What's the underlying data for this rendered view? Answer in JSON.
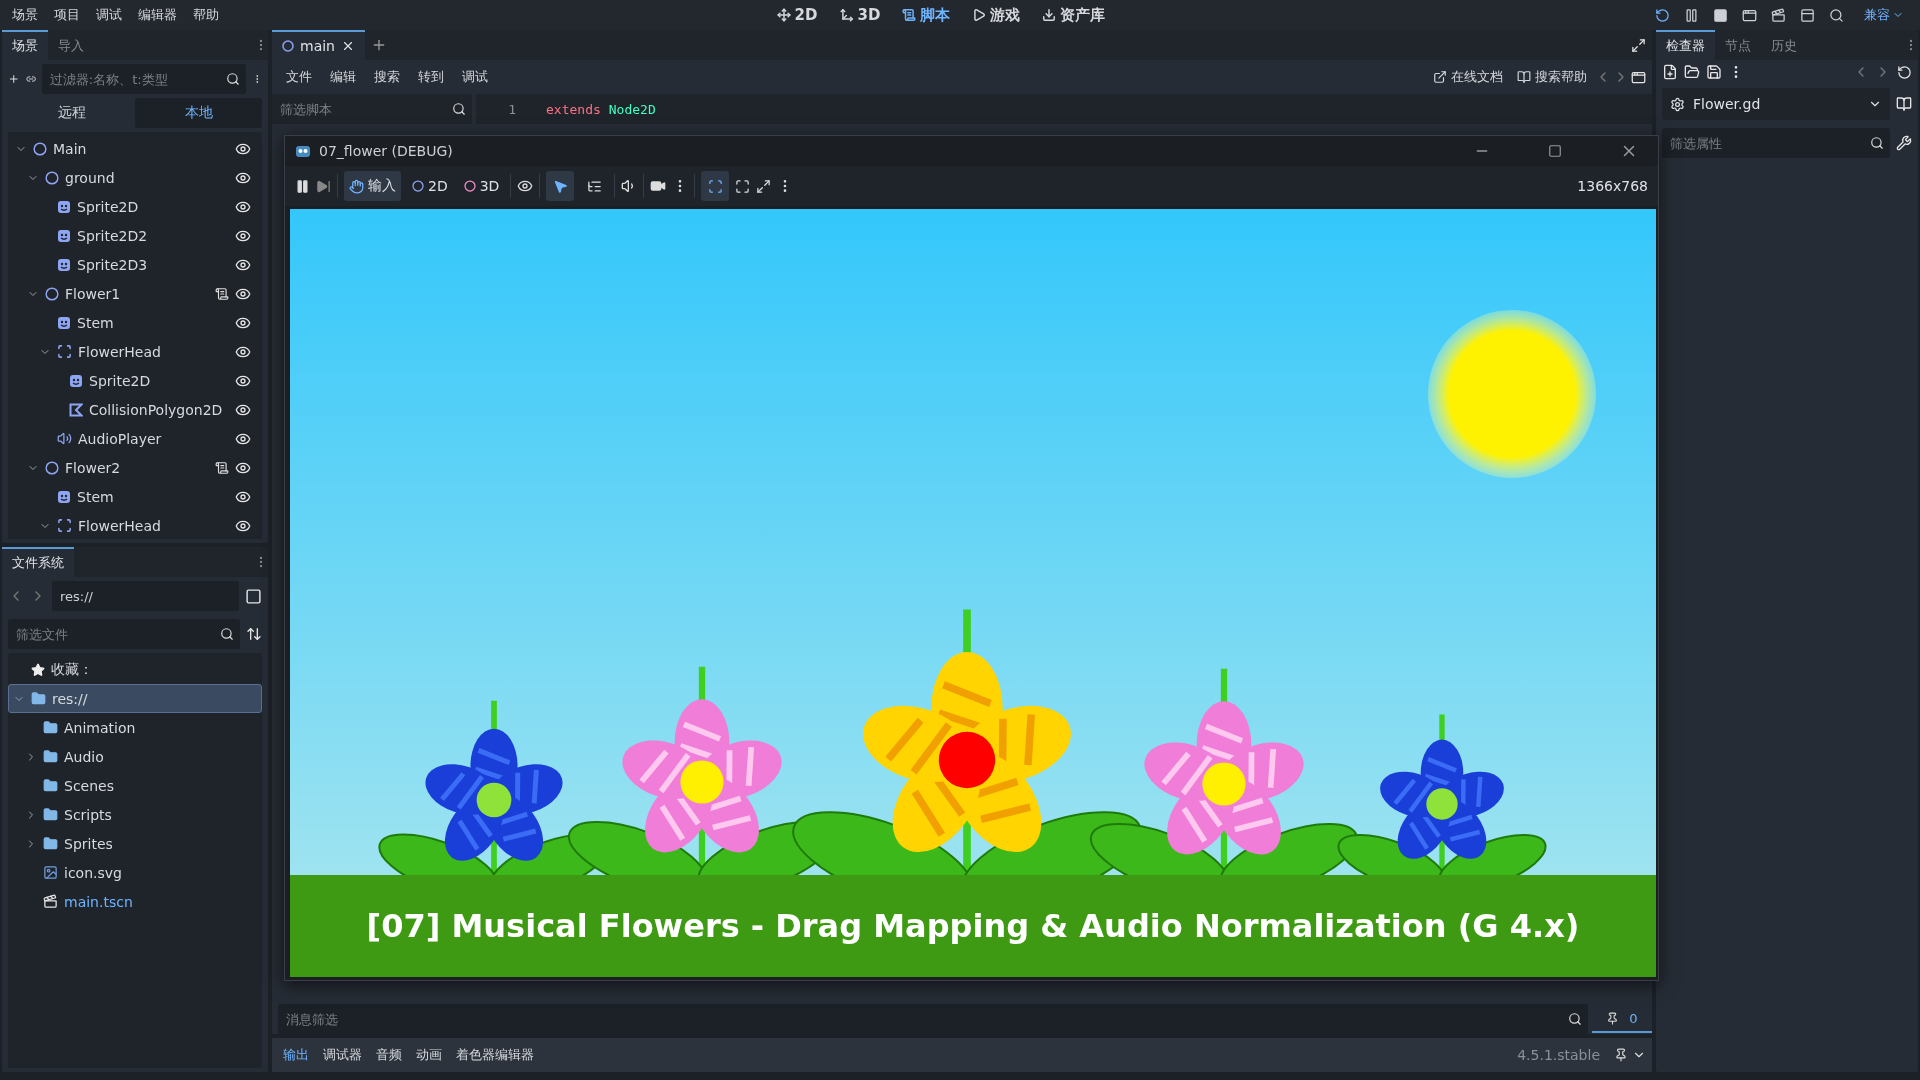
{
  "menu": [
    "场景",
    "项目",
    "调试",
    "编辑器",
    "帮助"
  ],
  "workspaces": [
    {
      "label": "2D",
      "kind": "planar",
      "selected": false
    },
    {
      "label": "3D",
      "kind": "spatial",
      "selected": false
    },
    {
      "label": "脚本",
      "kind": "script",
      "selected": true
    },
    {
      "label": "游戏",
      "kind": "game",
      "selected": false
    },
    {
      "label": "资产库",
      "kind": "assetlib",
      "selected": false
    }
  ],
  "renderer": "兼容",
  "scene_dock": {
    "tabs": [
      {
        "label": "场景",
        "selected": true
      },
      {
        "label": "导入",
        "selected": false
      }
    ],
    "filter_placeholder": "过滤器:名称、t:类型",
    "modes": [
      {
        "label": "远程",
        "selected": false
      },
      {
        "label": "本地",
        "selected": true
      }
    ],
    "tree": [
      {
        "name": "Main",
        "kind": "node2d",
        "expanded": true,
        "script": false,
        "children": [
          {
            "name": "ground",
            "kind": "node2d",
            "expanded": true,
            "script": false,
            "children": [
              {
                "name": "Sprite2D",
                "kind": "sprite",
                "script": false
              },
              {
                "name": "Sprite2D2",
                "kind": "sprite",
                "script": false
              },
              {
                "name": "Sprite2D3",
                "kind": "sprite",
                "script": false
              }
            ]
          },
          {
            "name": "Flower1",
            "kind": "node2d",
            "expanded": true,
            "script": true,
            "children": [
              {
                "name": "Stem",
                "kind": "sprite",
                "script": false
              },
              {
                "name": "FlowerHead",
                "kind": "area",
                "expanded": true,
                "script": false,
                "children": [
                  {
                    "name": "Sprite2D",
                    "kind": "sprite",
                    "script": false
                  },
                  {
                    "name": "CollisionPolygon2D",
                    "kind": "collision",
                    "script": false
                  }
                ]
              },
              {
                "name": "AudioPlayer",
                "kind": "audio",
                "script": false
              }
            ]
          },
          {
            "name": "Flower2",
            "kind": "node2d",
            "expanded": true,
            "script": true,
            "children": [
              {
                "name": "Stem",
                "kind": "sprite",
                "script": false
              },
              {
                "name": "FlowerHead",
                "kind": "area",
                "expanded": true,
                "script": false
              }
            ]
          }
        ]
      }
    ]
  },
  "filesystem": {
    "tab": "文件系统",
    "path": "res://",
    "filter_placeholder": "筛选文件",
    "favorites": "收藏：",
    "tree": [
      {
        "name": "res://",
        "kind": "folder",
        "expanded": true,
        "selected": true,
        "opened": false,
        "children": [
          {
            "name": "Animation",
            "kind": "folder",
            "selected": false,
            "opened": false
          },
          {
            "name": "Audio",
            "kind": "folder",
            "expanded": false,
            "selected": false,
            "opened": false
          },
          {
            "name": "Scenes",
            "kind": "folder",
            "selected": false,
            "opened": false
          },
          {
            "name": "Scripts",
            "kind": "folder",
            "expanded": false,
            "selected": false,
            "opened": false
          },
          {
            "name": "Sprites",
            "kind": "folder",
            "expanded": false,
            "selected": false,
            "opened": false
          },
          {
            "name": "icon.svg",
            "kind": "image",
            "selected": false,
            "opened": false
          },
          {
            "name": "main.tscn",
            "kind": "scene",
            "selected": false,
            "opened": true
          }
        ]
      }
    ]
  },
  "editor": {
    "tabs": [
      {
        "label": "main",
        "selected": true
      }
    ],
    "script_menu": [
      "文件",
      "编辑",
      "搜索",
      "转到",
      "调试"
    ],
    "online_docs": "在线文档",
    "search_help": "搜索帮助",
    "script_filter_placeholder": "筛选脚本",
    "code": [
      {
        "number": "1",
        "keyword": "extends",
        "type": "Node2D"
      }
    ]
  },
  "debug_window": {
    "title": "07_flower (DEBUG)",
    "input_label": "输入",
    "input_selected": true,
    "view_modes": [
      {
        "label": "2D",
        "kind": "planar"
      },
      {
        "label": "3D",
        "kind": "spatial"
      }
    ],
    "tools": [
      {
        "kind": "select",
        "selected": true
      },
      {
        "kind": "list",
        "selected": false
      }
    ],
    "camera_override": true,
    "resolution": "1366x768",
    "game_title": "[07] Musical Flowers - Drag Mapping & Audio Normalization (G 4.x)"
  },
  "bottom_panel": {
    "message_filter_placeholder": "消息筛选",
    "count": "0",
    "tabs": [
      {
        "label": "输出",
        "selected": true
      },
      {
        "label": "调试器",
        "selected": false
      },
      {
        "label": "音频",
        "selected": false
      },
      {
        "label": "动画",
        "selected": false
      },
      {
        "label": "着色器编辑器",
        "selected": false
      }
    ],
    "version": "4.5.1.stable"
  },
  "inspector": {
    "tabs": [
      {
        "label": "检查器",
        "selected": true
      },
      {
        "label": "节点",
        "selected": false
      },
      {
        "label": "历史",
        "selected": false
      }
    ],
    "resource": "Flower.gd",
    "filter_placeholder": "筛选属性"
  }
}
